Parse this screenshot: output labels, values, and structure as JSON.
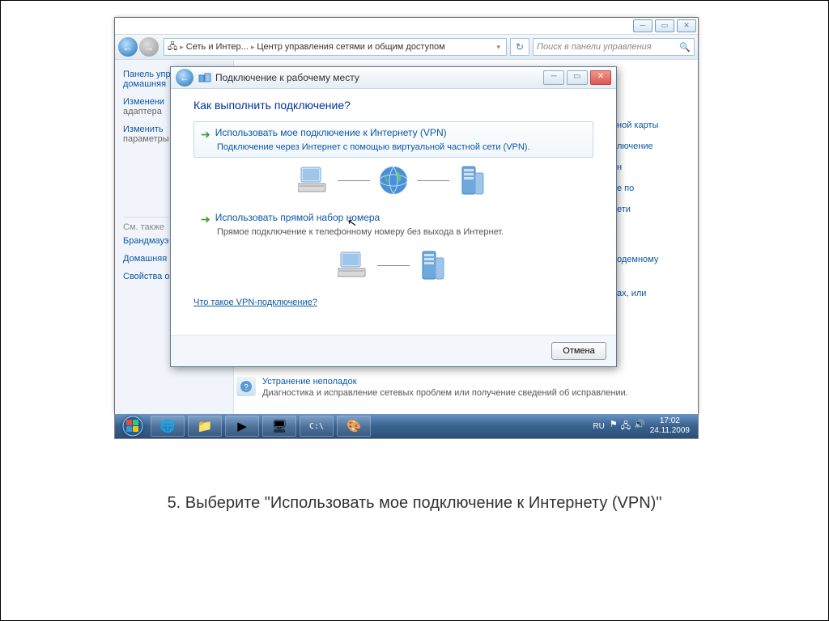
{
  "explorer": {
    "breadcrumb": {
      "group": "Сеть и Интер...",
      "page": "Центр управления сетями и общим доступом"
    },
    "search_placeholder": "Поиск в панели управления",
    "sidebar": {
      "link1a": "Панель упр",
      "link1b": "домашняя",
      "link2a": "Изменени",
      "link2b": "адаптера",
      "link3a": "Изменить",
      "link3b": "параметры",
      "see_also": "См. также",
      "s1": "Брандмауэ",
      "s2": "Домашняя группа",
      "s3": "Свойства обозревателя"
    },
    "right": {
      "r1": "ной карты",
      "r2": "лючение",
      "r3": "н",
      "r4": "е по",
      "r5": "ети",
      "r6": "одемному",
      "r7": "ах, или"
    },
    "trouble": {
      "title": "Устранение неполадок",
      "desc": "Диагностика и исправление сетевых проблем или получение сведений об исправлении."
    }
  },
  "dialog": {
    "title": "Подключение к рабочему месту",
    "heading": "Как выполнить подключение?",
    "opt1": {
      "title": "Использовать мое подключение к Интернету (VPN)",
      "desc": "Подключение через Интернет с помощью виртуальной частной сети (VPN)."
    },
    "opt2": {
      "title": "Использовать прямой набор номера",
      "desc": "Прямое подключение к телефонному номеру без выхода в Интернет."
    },
    "vpn_link": "Что такое VPN-подключение?",
    "cancel": "Отмена"
  },
  "taskbar": {
    "lang": "RU",
    "time": "17:02",
    "date": "24.11.2009"
  },
  "caption": "5. Выберите \"Использовать мое подключение к Интернету (VPN)\""
}
